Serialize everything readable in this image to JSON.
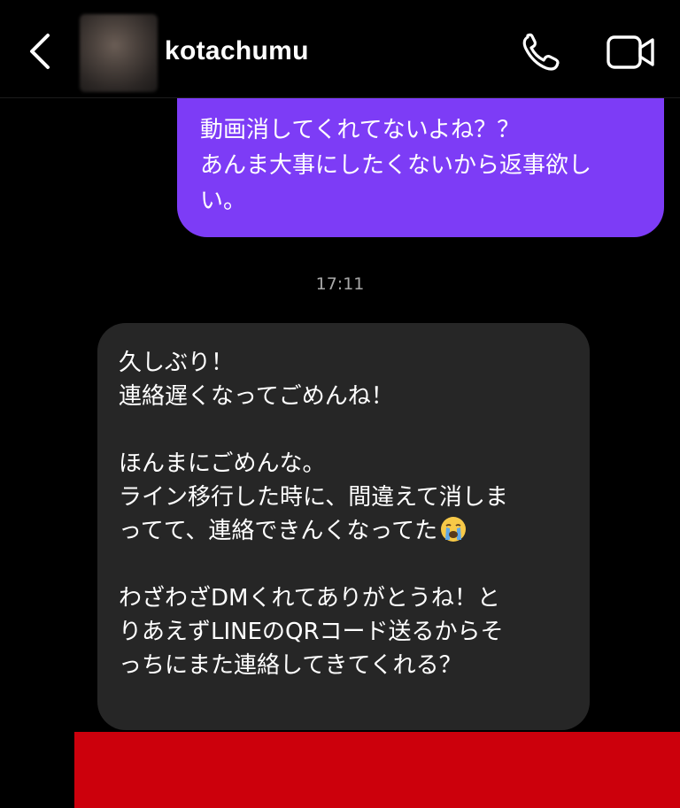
{
  "header": {
    "username": "kotachumu",
    "icons": {
      "back": "chevron-left-icon",
      "call": "phone-icon",
      "video": "video-camera-icon"
    }
  },
  "messages": {
    "sent": {
      "text": "動画消してくれてないよね？？\nあんま大事にしたくないから返事欲し\nい。"
    },
    "timestamp": "17:11",
    "received": {
      "paragraph1": "久しぶり！\n連絡遅くなってごめんね！",
      "paragraph2": "ほんまにごめんな。\nライン移行した時に、間違えて消しま\nってて、連絡できんくなってた",
      "paragraph3": "わざわざDMくれてありがとうね！と\nりあえずLINEのQRコード送るからそ\nっちにまた連絡してきてくれる？"
    }
  },
  "colors": {
    "background": "#000000",
    "sent_bubble": "#7d3cf6",
    "received_bubble": "#262626",
    "timestamp": "#a8a8a8",
    "redaction": "#cc000c"
  }
}
